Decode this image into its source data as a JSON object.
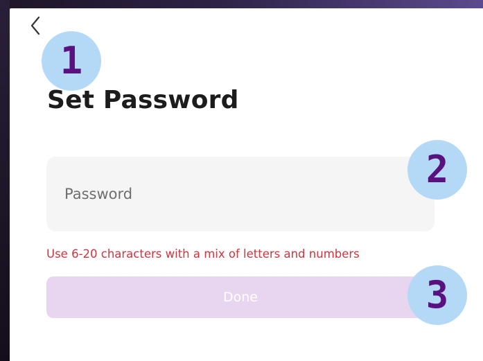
{
  "header": {
    "back_icon": "chevron-left-icon",
    "title": "Set Password"
  },
  "form": {
    "password_placeholder": "Password",
    "password_value": "",
    "hint": "Use 6-20 characters with a mix of letters and numbers",
    "done_label": "Done"
  },
  "annotations": {
    "badge_1": "1",
    "badge_2": "2",
    "badge_3": "3"
  },
  "colors": {
    "accent_disabled": "#e8d5f0",
    "hint_error": "#d0343c",
    "badge_fill": "#b3d9f7",
    "badge_text": "#5a1180"
  }
}
